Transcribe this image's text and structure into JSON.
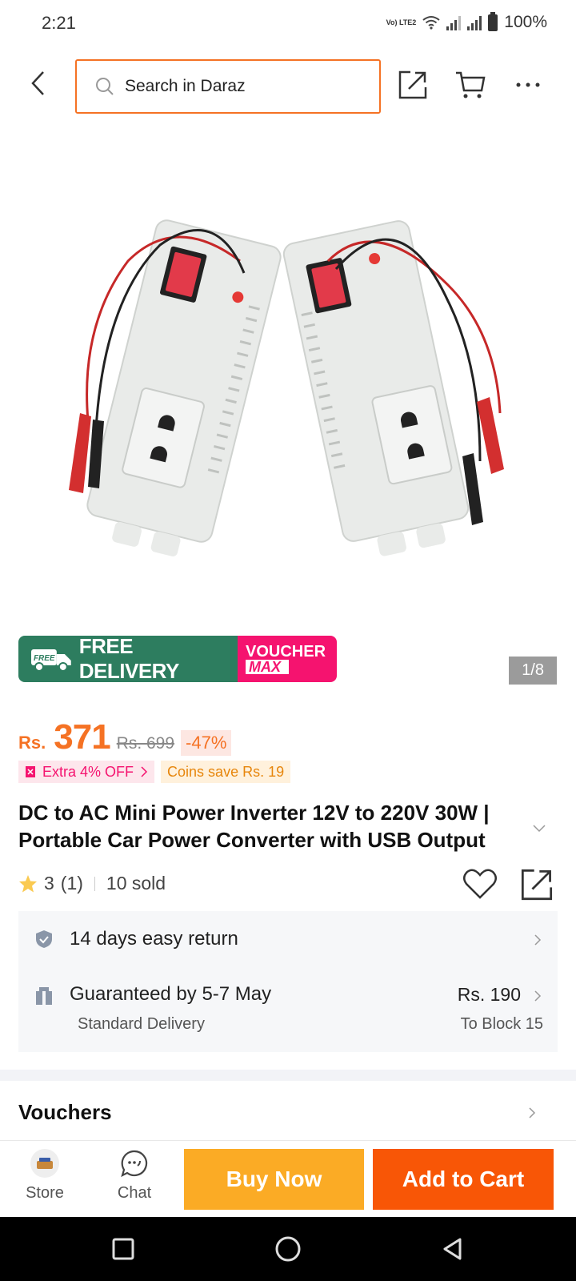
{
  "status_bar": {
    "time": "2:21",
    "volte_label": "Vo) LTE2",
    "battery": "100%"
  },
  "header": {
    "search_placeholder": "Search in Daraz"
  },
  "gallery": {
    "counter": "1/8"
  },
  "banner": {
    "free_label": "FREE",
    "free_delivery": "FREE DELIVERY",
    "voucher": "VOUCHER",
    "max": "MAX"
  },
  "price": {
    "currency": "Rs.",
    "current": "371",
    "original": "Rs. 699",
    "discount": "-47%"
  },
  "promos": {
    "extra": "Extra 4% OFF",
    "coins": "Coins save Rs. 19"
  },
  "product": {
    "title": "DC to AC Mini Power Inverter 12V to 220V 30W | Portable Car Power Converter with USB Output",
    "rating": "3",
    "reviews": "(1)",
    "sold": "10 sold"
  },
  "services": {
    "return_label": "14 days easy return",
    "delivery_label": "Guaranteed by 5-7 May",
    "delivery_type": "Standard Delivery",
    "delivery_price": "Rs. 190",
    "delivery_dest": "To Block 15"
  },
  "vouchers": {
    "title": "Vouchers"
  },
  "bottom_bar": {
    "store": "Store",
    "chat": "Chat",
    "buy_now": "Buy Now",
    "add_to_cart": "Add to Cart"
  },
  "colors": {
    "accent": "#f57224",
    "buy_now": "#fbab25",
    "add_to_cart": "#f85606",
    "free_delivery": "#2d7d5f",
    "voucher_max": "#f5136f"
  }
}
